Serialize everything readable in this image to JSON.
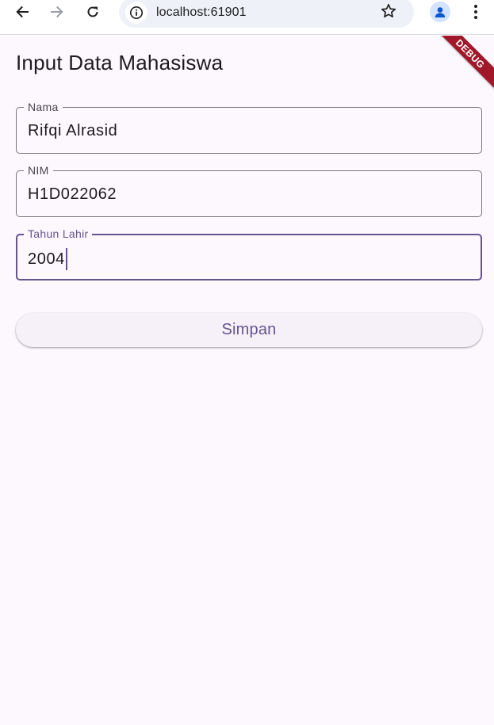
{
  "browser": {
    "url": "localhost:61901",
    "icons": [
      "back-arrow-icon",
      "forward-arrow-icon",
      "reload-icon",
      "site-info-icon",
      "bookmark-star-icon",
      "profile-icon",
      "more-menu-icon"
    ]
  },
  "app": {
    "title": "Input Data Mahasiswa",
    "debug_banner": "DEBUG",
    "fields": [
      {
        "label": "Nama",
        "value": "Rifqi Alrasid",
        "focused": false
      },
      {
        "label": "NIM",
        "value": "H1D022062",
        "focused": false
      },
      {
        "label": "Tahun Lahir",
        "value": "2004",
        "focused": true
      }
    ],
    "save_label": "Simpan",
    "colors": {
      "background": "#fdf7fe",
      "primary": "#65558f",
      "outline": "#79747e",
      "debug_ribbon": "#a0182a"
    }
  }
}
